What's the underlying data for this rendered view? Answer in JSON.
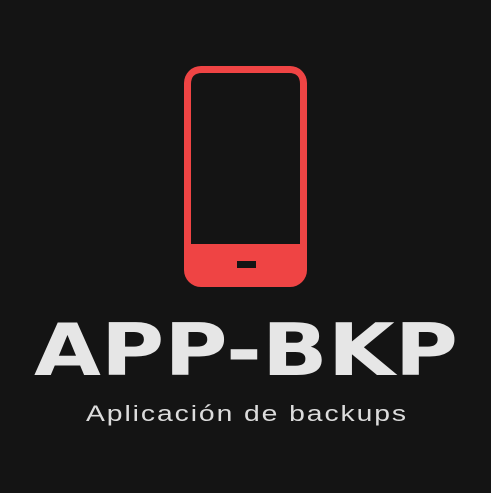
{
  "logo": {
    "title": "APP-BKP",
    "subtitle": "Aplicación de backups",
    "icon": "smartphone-icon",
    "colors": {
      "background": "#141414",
      "phone": "#ef4444",
      "text": "#e6e6e6"
    }
  }
}
